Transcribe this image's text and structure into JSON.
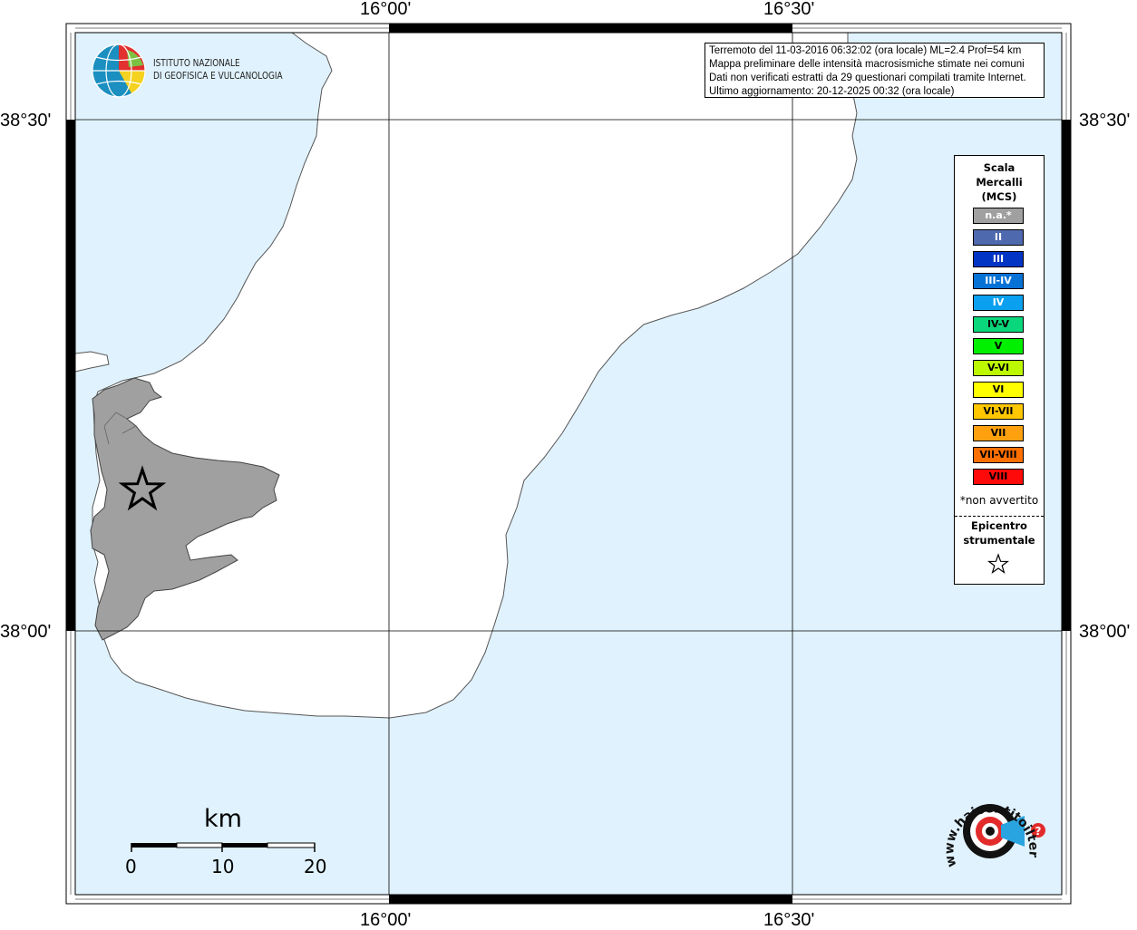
{
  "map": {
    "top_labels": [
      "16°00'",
      "16°30'"
    ],
    "bottom_labels": [
      "16°00'",
      "16°30'"
    ],
    "left_labels": [
      "38°30'",
      "38°00'"
    ],
    "right_labels": [
      "38°30'",
      "38°00'"
    ],
    "colors": {
      "sea": "#e0f2fd",
      "land": "#ffffff",
      "felt_area": "#a0a0a0",
      "frame": "#000000"
    }
  },
  "info": {
    "lines": [
      "Terremoto del 11-03-2016 06:32:02 (ora locale) ML=2.4 Prof=54 km",
      "Mappa preliminare delle intensità macrosismiche stimate nei comuni",
      "Dati non verificati estratti da 29 questionari compilati tramite Internet.",
      "Ultimo aggiornamento: 20-12-2025 00:32 (ora locale)"
    ]
  },
  "logo": {
    "line1": "ISTITUTO NAZIONALE",
    "line2": "DI GEOFISICA E VULCANOLOGIA",
    "icon": "ingv-globe-icon"
  },
  "legend": {
    "title_lines": [
      "Scala",
      "Mercalli",
      "(MCS)"
    ],
    "items": [
      {
        "label": "n.a.*",
        "color": "#a0a0a0",
        "text_color": "#ffffff"
      },
      {
        "label": "II",
        "color": "#4f69af",
        "text_color": "#ffffff"
      },
      {
        "label": "III",
        "color": "#0335c4",
        "text_color": "#ffffff"
      },
      {
        "label": "III-IV",
        "color": "#0772d6",
        "text_color": "#ffffff"
      },
      {
        "label": "IV",
        "color": "#0aa0ef",
        "text_color": "#ffffff"
      },
      {
        "label": "IV-V",
        "color": "#0ad77b",
        "text_color": "#000000"
      },
      {
        "label": "V",
        "color": "#00f000",
        "text_color": "#000000"
      },
      {
        "label": "V-VI",
        "color": "#bcf800",
        "text_color": "#000000"
      },
      {
        "label": "VI",
        "color": "#ffff00",
        "text_color": "#000000"
      },
      {
        "label": "VI-VII",
        "color": "#ffc700",
        "text_color": "#000000"
      },
      {
        "label": "VII",
        "color": "#ffa10f",
        "text_color": "#000000"
      },
      {
        "label": "VII-VIII",
        "color": "#ff6f00",
        "text_color": "#000000"
      },
      {
        "label": "VIII",
        "color": "#ff0a0a",
        "text_color": "#000000"
      }
    ],
    "note": "*non avvertito",
    "epicenter_lines": [
      "Epicentro",
      "strumentale"
    ],
    "epicenter_icon": "star-icon"
  },
  "scalebar": {
    "unit": "km",
    "ticks": [
      "0",
      "10",
      "20"
    ]
  },
  "watermark": {
    "text": "www.haisentitoilterremoto.it",
    "icon": "hst-logo-icon",
    "question_mark": "?"
  }
}
